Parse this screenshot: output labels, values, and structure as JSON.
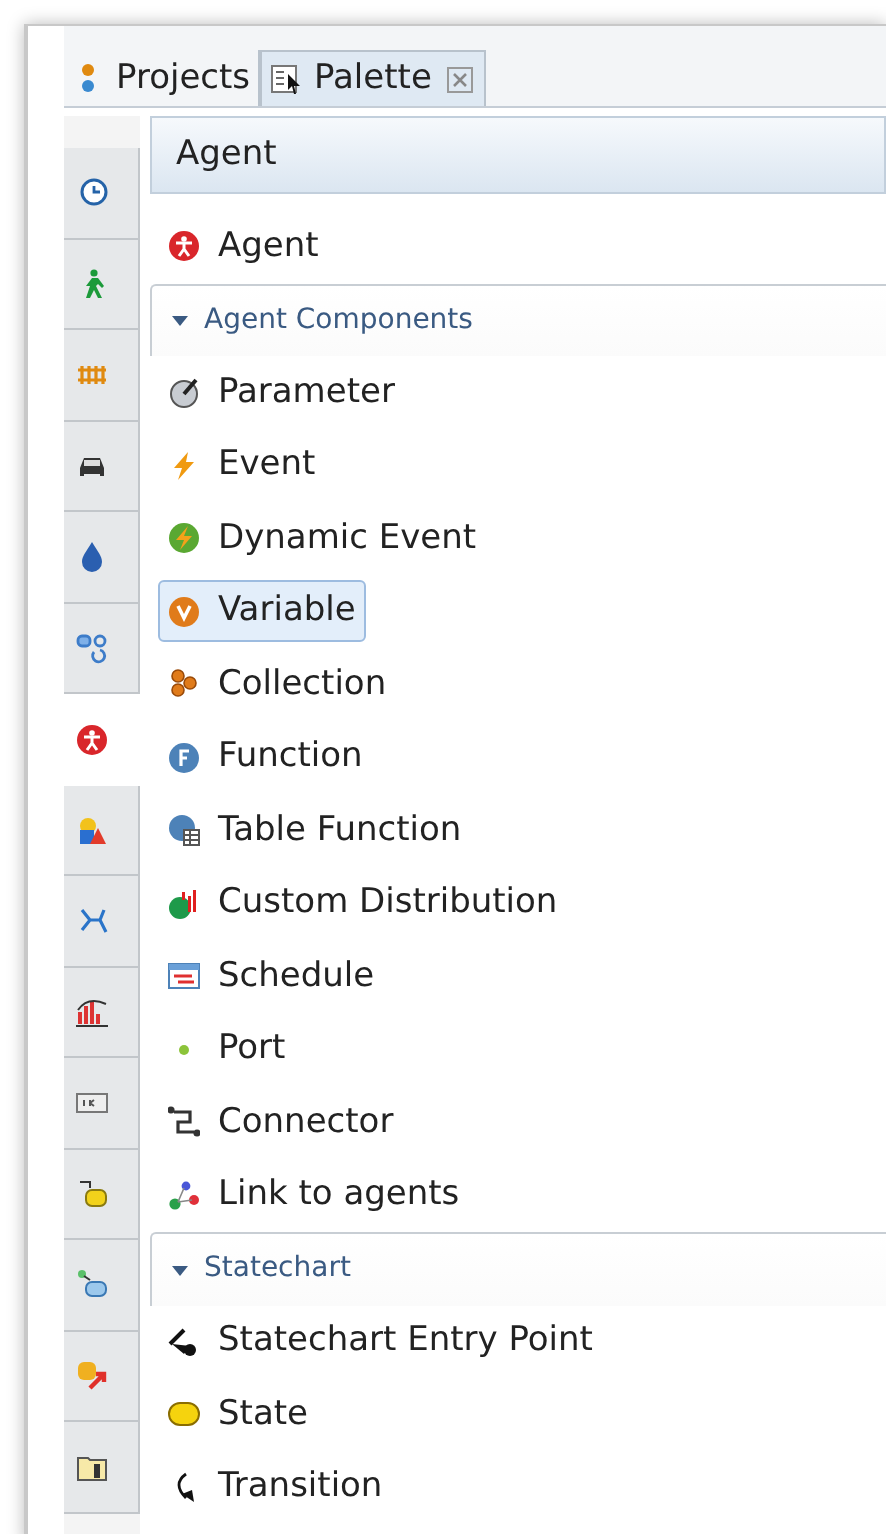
{
  "tabs": [
    {
      "label": "Projects",
      "selected": false,
      "closable": false
    },
    {
      "label": "Palette",
      "selected": true,
      "closable": true
    }
  ],
  "sidebar": {
    "items": [
      {
        "selected": false
      },
      {
        "selected": false
      },
      {
        "selected": false
      },
      {
        "selected": false
      },
      {
        "selected": false
      },
      {
        "selected": false
      },
      {
        "selected": true
      },
      {
        "selected": false
      },
      {
        "selected": false
      },
      {
        "selected": false
      },
      {
        "selected": false
      },
      {
        "selected": false
      },
      {
        "selected": false
      },
      {
        "selected": false
      },
      {
        "selected": false
      }
    ]
  },
  "palette": {
    "category": "Agent",
    "items": [
      {
        "kind": "item",
        "label": "Agent",
        "selected": false
      },
      {
        "kind": "section",
        "label": "Agent Components",
        "expanded": true
      },
      {
        "kind": "item",
        "label": "Parameter",
        "selected": false
      },
      {
        "kind": "item",
        "label": "Event",
        "selected": false
      },
      {
        "kind": "item",
        "label": "Dynamic Event",
        "selected": false
      },
      {
        "kind": "item",
        "label": "Variable",
        "selected": true
      },
      {
        "kind": "item",
        "label": "Collection",
        "selected": false
      },
      {
        "kind": "item",
        "label": "Function",
        "selected": false
      },
      {
        "kind": "item",
        "label": "Table Function",
        "selected": false
      },
      {
        "kind": "item",
        "label": "Custom Distribution",
        "selected": false
      },
      {
        "kind": "item",
        "label": "Schedule",
        "selected": false
      },
      {
        "kind": "item",
        "label": "Port",
        "selected": false
      },
      {
        "kind": "item",
        "label": "Connector",
        "selected": false
      },
      {
        "kind": "item",
        "label": "Link to agents",
        "selected": false
      },
      {
        "kind": "section",
        "label": "Statechart",
        "expanded": true
      },
      {
        "kind": "item",
        "label": "Statechart Entry Point",
        "selected": false
      },
      {
        "kind": "item",
        "label": "State",
        "selected": false
      },
      {
        "kind": "item",
        "label": "Transition",
        "selected": false
      }
    ]
  }
}
